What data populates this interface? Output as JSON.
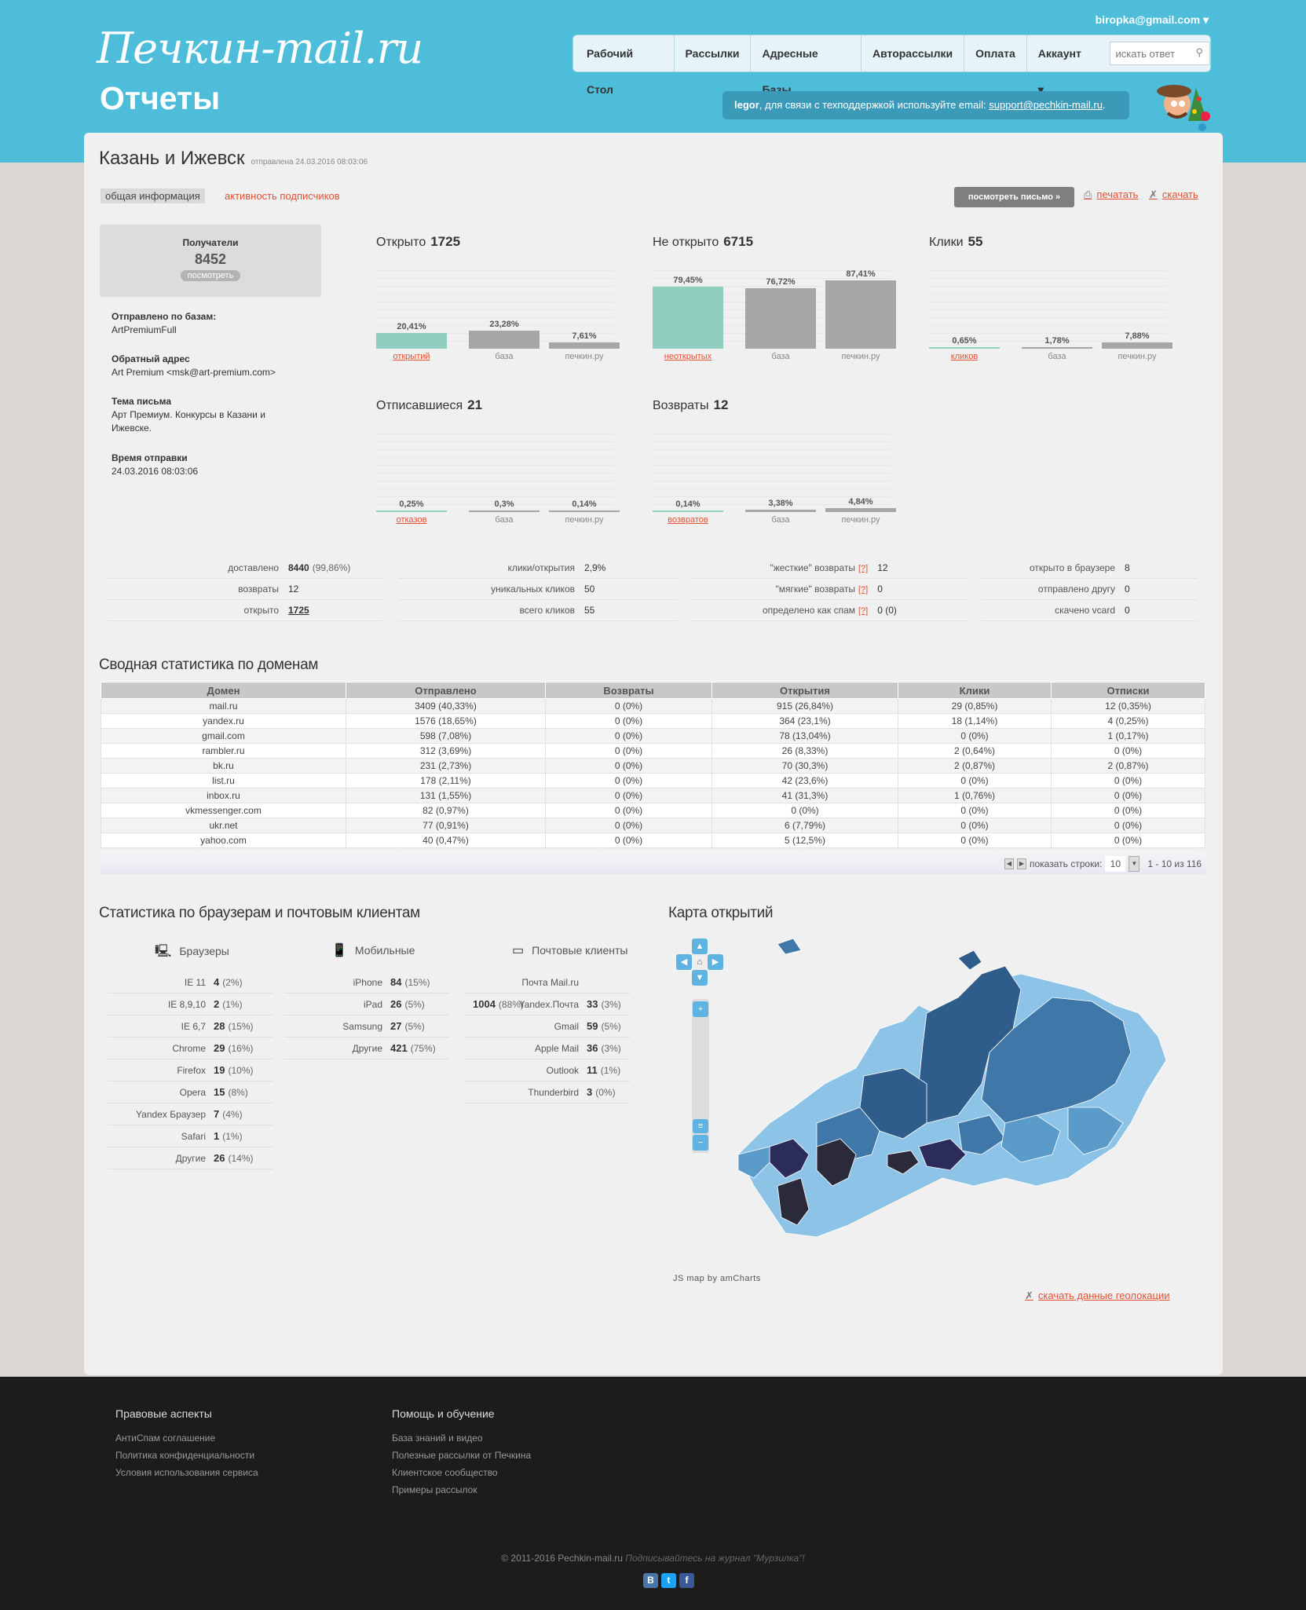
{
  "app": {
    "logo": "Печкин-mail.ru",
    "page_title": "Отчеты",
    "user_email": "biropka@gmail.com ▾"
  },
  "nav": {
    "items": [
      "Рабочий Стол",
      "Рассылки",
      "Адресные Базы",
      "Авторассылки",
      "Оплата",
      "Аккаунт ▾"
    ],
    "search_placeholder": "искать ответ"
  },
  "support": {
    "user": "legor",
    "text": ", для связи с техподдержкой используйте email: ",
    "email": "support@pechkin-mail.ru",
    "end": "."
  },
  "report": {
    "title": "Казань и Ижевск",
    "sent_at": "отправлена 24.03.2016 08:03:06",
    "tabs": [
      "общая информация",
      "активность подписчиков"
    ],
    "view_button": "посмотреть письмо »",
    "print_label": "печатать",
    "download_label": "скачать"
  },
  "recipients": {
    "label": "Получатели",
    "value": "8452",
    "button": "посмотреть"
  },
  "meta": [
    {
      "label": "Отправлено по базам:",
      "value": "ArtPremiumFull"
    },
    {
      "label": "Обратный адрес",
      "value": "Art Premium <msk@art-premium.com>"
    },
    {
      "label": "Тема письма",
      "value": "Арт Премиум. Конкурсы в Казани и Ижевске."
    },
    {
      "label": "Время отправки",
      "value": "24.03.2016 08:03:06"
    }
  ],
  "charts": [
    {
      "title": "Открыто",
      "total": "1725",
      "accent": "#8ecfc0",
      "bars": [
        {
          "label": "открытий",
          "pct": "20,41%",
          "value": 20.41
        },
        {
          "label": "база",
          "pct": "23,28%",
          "value": 23.28
        },
        {
          "label": "печкин.ру",
          "pct": "7,61%",
          "value": 7.61
        }
      ]
    },
    {
      "title": "Не открыто",
      "total": "6715",
      "accent": "#8ecfc0",
      "bars": [
        {
          "label": "неоткрытых",
          "pct": "79,45%",
          "value": 79.45
        },
        {
          "label": "база",
          "pct": "76,72%",
          "value": 76.72
        },
        {
          "label": "печкин.ру",
          "pct": "87,41%",
          "value": 87.41
        }
      ]
    },
    {
      "title": "Клики",
      "total": "55",
      "accent": "#8ecfc0",
      "bars": [
        {
          "label": "кликов",
          "pct": "0,65%",
          "value": 0.65
        },
        {
          "label": "база",
          "pct": "1,78%",
          "value": 1.78
        },
        {
          "label": "печкин.ру",
          "pct": "7,88%",
          "value": 7.88
        }
      ]
    },
    {
      "title": "Отписавшиеся",
      "total": "21",
      "accent": "#8ecfc0",
      "bars": [
        {
          "label": "отказов",
          "pct": "0,25%",
          "value": 0.25
        },
        {
          "label": "база",
          "pct": "0,3%",
          "value": 0.3
        },
        {
          "label": "печкин.ру",
          "pct": "0,14%",
          "value": 0.14
        }
      ]
    },
    {
      "title": "Возвраты",
      "total": "12",
      "accent": "#8ecfc0",
      "bars": [
        {
          "label": "возвратов",
          "pct": "0,14%",
          "value": 0.14
        },
        {
          "label": "база",
          "pct": "3,38%",
          "value": 3.38
        },
        {
          "label": "печкин.ру",
          "pct": "4,84%",
          "value": 4.84
        }
      ]
    }
  ],
  "stats": [
    [
      {
        "k": "доставлено",
        "v": "8440",
        "extra": "(99,86%)"
      },
      {
        "k": "возвраты",
        "v": "12"
      },
      {
        "k": "открыто",
        "v": "1725"
      }
    ],
    [
      {
        "k": "клики/открытия",
        "v": "2,9%"
      },
      {
        "k": "уникальных кликов",
        "v": "50"
      },
      {
        "k": "всего кликов",
        "v": "55"
      }
    ],
    [
      {
        "k": "\"жесткие\" возвраты",
        "q": "[?]",
        "v": "12"
      },
      {
        "k": "\"мягкие\" возвраты",
        "q": "[?]",
        "v": "0"
      },
      {
        "k": "определено как спам",
        "q": "[?]",
        "v": "0 (0)"
      }
    ],
    [
      {
        "k": "открыто в браузере",
        "v": "8"
      },
      {
        "k": "отправлено другу",
        "v": "0"
      },
      {
        "k": "скачено vcard",
        "v": "0"
      }
    ]
  ],
  "domains": {
    "title": "Сводная статистика по доменам",
    "headers": [
      "Домен",
      "Отправлено",
      "Возвраты",
      "Открытия",
      "Клики",
      "Отписки"
    ],
    "rows": [
      [
        "mail.ru",
        "3409 (40,33%)",
        "0 (0%)",
        "915 (26,84%)",
        "29 (0,85%)",
        "12 (0,35%)"
      ],
      [
        "yandex.ru",
        "1576 (18,65%)",
        "0 (0%)",
        "364 (23,1%)",
        "18 (1,14%)",
        "4 (0,25%)"
      ],
      [
        "gmail.com",
        "598 (7,08%)",
        "0 (0%)",
        "78 (13,04%)",
        "0 (0%)",
        "1 (0,17%)"
      ],
      [
        "rambler.ru",
        "312 (3,69%)",
        "0 (0%)",
        "26 (8,33%)",
        "2 (0,64%)",
        "0 (0%)"
      ],
      [
        "bk.ru",
        "231 (2,73%)",
        "0 (0%)",
        "70 (30,3%)",
        "2 (0,87%)",
        "2 (0,87%)"
      ],
      [
        "list.ru",
        "178 (2,11%)",
        "0 (0%)",
        "42 (23,6%)",
        "0 (0%)",
        "0 (0%)"
      ],
      [
        "inbox.ru",
        "131 (1,55%)",
        "0 (0%)",
        "41 (31,3%)",
        "1 (0,76%)",
        "0 (0%)"
      ],
      [
        "vkmessenger.com",
        "82 (0,97%)",
        "0 (0%)",
        "0 (0%)",
        "0 (0%)",
        "0 (0%)"
      ],
      [
        "ukr.net",
        "77 (0,91%)",
        "0 (0%)",
        "6 (7,79%)",
        "0 (0%)",
        "0 (0%)"
      ],
      [
        "yahoo.com",
        "40 (0,47%)",
        "0 (0%)",
        "5 (12,5%)",
        "0 (0%)",
        "0 (0%)"
      ]
    ],
    "pager": {
      "label": "показать строки:",
      "size": "10",
      "range": "1 - 10 из 116"
    }
  },
  "browsers": {
    "title": "Статистика по браузерам и почтовым клиентам",
    "groups": [
      {
        "name": "Браузеры",
        "icon": "laptop-icon",
        "items": [
          [
            "IE 11",
            "4",
            "(2%)"
          ],
          [
            "IE 8,9,10",
            "2",
            "(1%)"
          ],
          [
            "IE 6,7",
            "28",
            "(15%)"
          ],
          [
            "Chrome",
            "29",
            "(16%)"
          ],
          [
            "Firefox",
            "19",
            "(10%)"
          ],
          [
            "Opera",
            "15",
            "(8%)"
          ],
          [
            "Yandex Браузер",
            "7",
            "(4%)"
          ],
          [
            "Safari",
            "1",
            "(1%)"
          ],
          [
            "Другие",
            "26",
            "(14%)"
          ]
        ]
      },
      {
        "name": "Мобильные",
        "icon": "mobile-icon",
        "items": [
          [
            "iPhone",
            "84",
            "(15%)"
          ],
          [
            "iPad",
            "26",
            "(5%)"
          ],
          [
            "Samsung",
            "27",
            "(5%)"
          ],
          [
            "Другие",
            "421",
            "(75%)"
          ]
        ]
      },
      {
        "name": "Почтовые клиенты",
        "icon": "window-icon",
        "items": [
          [
            "Почта Mail.ru",
            "1004",
            "(88%)"
          ],
          [
            "Yandex.Почта",
            "33",
            "(3%)"
          ],
          [
            "Gmail",
            "59",
            "(5%)"
          ],
          [
            "Apple Mail",
            "36",
            "(3%)"
          ],
          [
            "Outlook",
            "11",
            "(1%)"
          ],
          [
            "Thunderbird",
            "3",
            "(0%)"
          ]
        ]
      }
    ]
  },
  "map": {
    "title": "Карта открытий",
    "credit": "JS map by amCharts",
    "download_label": "скачать данные геолокации",
    "colors": [
      "#2e5d8c",
      "#3f78a8",
      "#5b9bc9",
      "#8cc3e6",
      "#2a2a3a",
      "#2c2c5a"
    ]
  },
  "footer": {
    "cols": [
      {
        "title": "Правовые аспекты",
        "links": [
          "АнтиСпам соглашение",
          "Политика конфиденциальности",
          "Условия использования сервиса"
        ]
      },
      {
        "title": "Помощь и обучение",
        "links": [
          "База знаний и видео",
          "Полезные рассылки от Печкина",
          "Клиентское сообщество",
          "Примеры рассылок"
        ]
      }
    ],
    "copyright": "© 2011-2016 Pechkin-mail.ru",
    "slogan": "Подписывайтесь на журнал \"Мурзилка\"!",
    "social": [
      "В",
      "t",
      "f"
    ]
  }
}
